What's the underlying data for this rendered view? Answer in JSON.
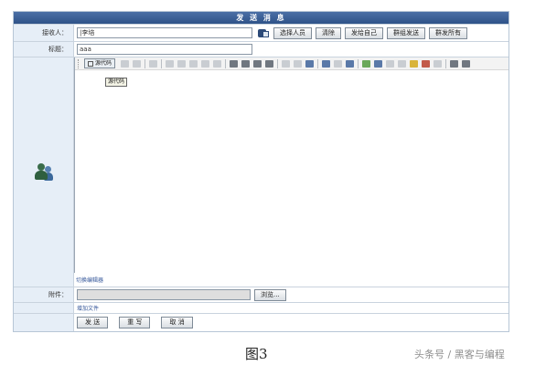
{
  "form": {
    "title": "发 送 消 息",
    "recipient": {
      "label": "接收人：",
      "value": "|李培",
      "buttons": [
        "选择人员",
        "清除",
        "发给自己",
        "群组发送",
        "群发所有"
      ]
    },
    "subject": {
      "label": "标题：",
      "value": "aaa"
    },
    "editor": {
      "source_button": "源代码",
      "tooltip": "源代码",
      "footer_link": "切换编辑器"
    },
    "attachment": {
      "label": "附件：",
      "browse_button": "浏览..."
    },
    "add_file_link": "增加文件",
    "actions": [
      "发 送",
      "重 写",
      "取 消"
    ]
  },
  "caption": "图3",
  "watermark": "头条号 / 黑客与编程"
}
